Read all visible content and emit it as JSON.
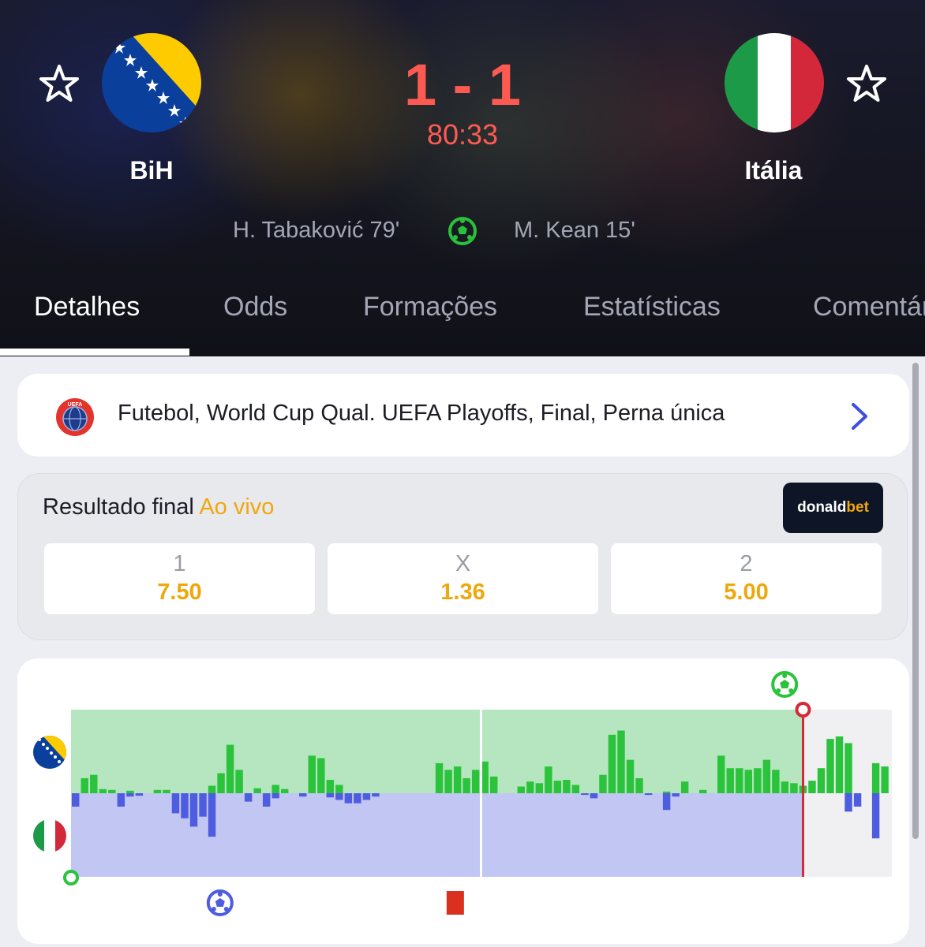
{
  "match": {
    "home": {
      "name": "BiH",
      "flag": "bosnia-flag"
    },
    "away": {
      "name": "Itália",
      "flag": "italy-flag"
    },
    "score": "1 - 1",
    "clock": "80:33",
    "home_scorer": "H. Tabaković 79'",
    "away_scorer": "M. Kean 15'"
  },
  "tabs": [
    "Detalhes",
    "Odds",
    "Formações",
    "Estatísticas",
    "Comentários"
  ],
  "active_tab": "Detalhes",
  "competition": {
    "text": "Futebol, World Cup Qual. UEFA Playoffs, Final, Perna única",
    "icon": "uefa-logo"
  },
  "odds": {
    "title": "Resultado final",
    "live_label": "Ao vivo",
    "bookmaker_prefix": "donald",
    "bookmaker_suffix": "bet",
    "options": [
      {
        "label": "1",
        "value": "7.50"
      },
      {
        "label": "X",
        "value": "1.36"
      },
      {
        "label": "2",
        "value": "5.00"
      }
    ]
  },
  "colors": {
    "home_bar": "#2cc33c",
    "away_bar": "#4e5de0",
    "score": "#ff5a52",
    "odds": "#f0a70c"
  },
  "chart_data": {
    "type": "bar",
    "description_units": "minute-by-minute momentum, positive = BiH, negative = Itália",
    "current_minute": 80.5,
    "halftime_minute": 45,
    "ylim": [
      -100,
      100
    ],
    "home_values": [
      0,
      18,
      22,
      5,
      4,
      0,
      3,
      0,
      0,
      4,
      4,
      0,
      0,
      0,
      0,
      9,
      24,
      58,
      28,
      0,
      6,
      0,
      10,
      5,
      0,
      0,
      45,
      42,
      16,
      10,
      0,
      0,
      0,
      0,
      0,
      0,
      0,
      0,
      0,
      0,
      36,
      28,
      32,
      18,
      28,
      38,
      20,
      0,
      0,
      8,
      14,
      12,
      32,
      15,
      16,
      10,
      0,
      0,
      22,
      70,
      75,
      40,
      18,
      0,
      0,
      2,
      0,
      14,
      0,
      4,
      0,
      45,
      30,
      30,
      28,
      30,
      40,
      28,
      14,
      12,
      9,
      15,
      30,
      65,
      68,
      60,
      0,
      0,
      36,
      32
    ],
    "away_values": [
      -16,
      0,
      0,
      0,
      0,
      -16,
      -4,
      -3,
      0,
      0,
      0,
      -24,
      -30,
      -40,
      -28,
      -52,
      0,
      0,
      0,
      -10,
      0,
      -16,
      -6,
      0,
      0,
      -4,
      0,
      0,
      -5,
      -8,
      -12,
      -12,
      -8,
      -4,
      0,
      0,
      0,
      0,
      0,
      0,
      0,
      0,
      0,
      0,
      0,
      0,
      0,
      0,
      0,
      0,
      0,
      0,
      0,
      0,
      0,
      0,
      -2,
      -6,
      0,
      0,
      0,
      0,
      0,
      -2,
      0,
      -20,
      -4,
      0,
      0,
      0,
      0,
      0,
      0,
      0,
      0,
      0,
      0,
      0,
      0,
      0,
      0,
      0,
      0,
      0,
      0,
      -22,
      -16,
      0,
      -54,
      0
    ],
    "events": [
      {
        "minute": 0,
        "type": "kickoff-marker"
      },
      {
        "minute": 15,
        "type": "goal",
        "team": "away"
      },
      {
        "minute": 40,
        "type": "red-card",
        "team": "away"
      },
      {
        "minute": 79,
        "type": "goal",
        "team": "home"
      }
    ]
  }
}
